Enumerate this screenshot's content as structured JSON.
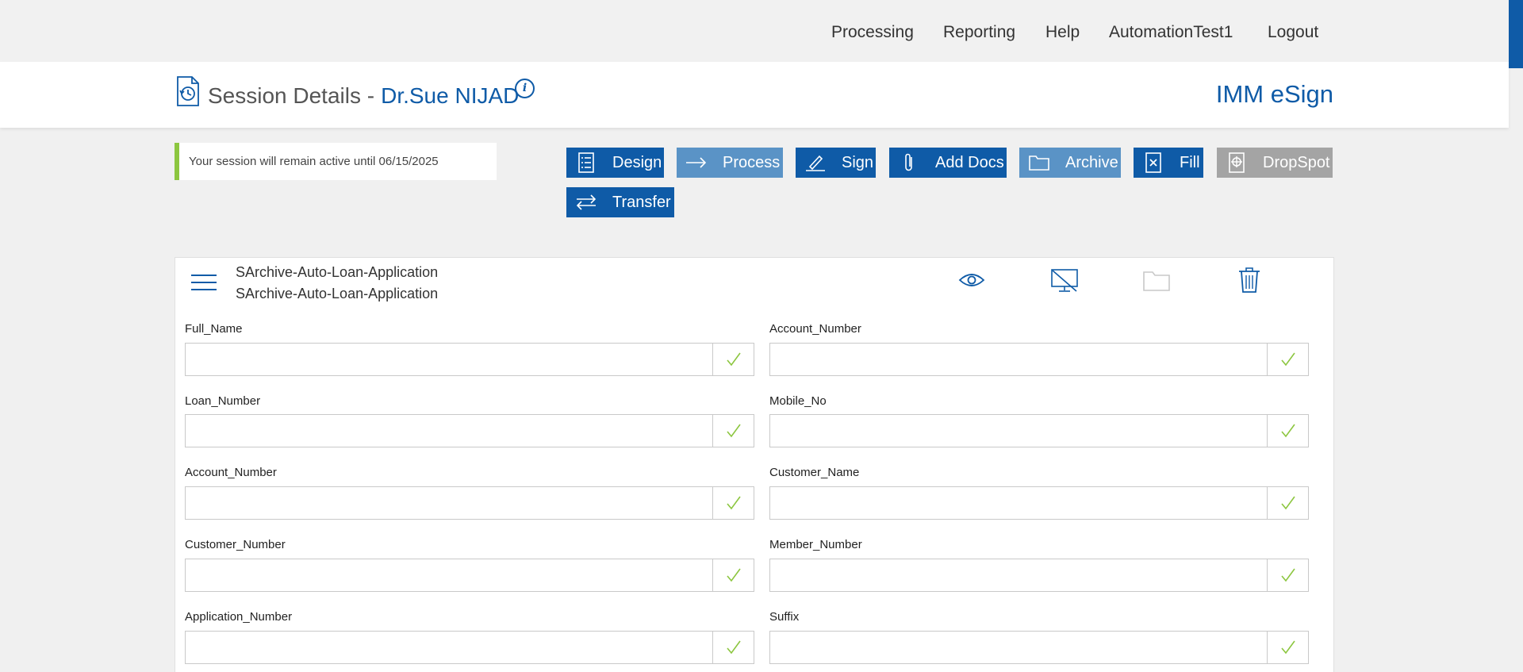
{
  "nav": {
    "items": [
      "Processing",
      "Reporting",
      "Help",
      "AutomationTest1",
      "Logout"
    ]
  },
  "header": {
    "title": "Session Details -",
    "client": "Dr.Sue NIJAD",
    "brand": "IMM eSign"
  },
  "notice": {
    "text": "Your session will remain active until 06/15/2025"
  },
  "actions": [
    {
      "label": "Design",
      "icon": "design-icon"
    },
    {
      "label": "Process",
      "icon": "arrow-right-icon"
    },
    {
      "label": "Sign",
      "icon": "pen-icon"
    },
    {
      "label": "Add Docs",
      "icon": "paperclip-icon"
    },
    {
      "label": "Archive",
      "icon": "folder-icon"
    },
    {
      "label": "Fill",
      "icon": "fill-icon"
    },
    {
      "label": "DropSpot",
      "icon": "dropspot-icon"
    },
    {
      "label": "Transfer",
      "icon": "transfer-icon"
    }
  ],
  "package": {
    "name_line1": "SArchive-Auto-Loan-Application",
    "name_line2": "SArchive-Auto-Loan-Application",
    "tools": [
      "eye-icon",
      "monitor-off-icon",
      "folder-icon",
      "trash-icon"
    ]
  },
  "fields": {
    "left": [
      {
        "label": "Full_Name",
        "value": ""
      },
      {
        "label": "Loan_Number",
        "value": ""
      },
      {
        "label": "Account_Number",
        "value": ""
      },
      {
        "label": "Customer_Number",
        "value": ""
      },
      {
        "label": "Application_Number",
        "value": ""
      }
    ],
    "right": [
      {
        "label": "Account_Number",
        "value": ""
      },
      {
        "label": "Mobile_No",
        "value": ""
      },
      {
        "label": "Customer_Name",
        "value": ""
      },
      {
        "label": "Member_Number",
        "value": ""
      },
      {
        "label": "Suffix",
        "value": ""
      }
    ]
  },
  "colors": {
    "primary": "#0f5ba7",
    "primary_light": "#5a93c6",
    "disabled": "#a4a4a4",
    "accent_green": "#8cc63f"
  }
}
